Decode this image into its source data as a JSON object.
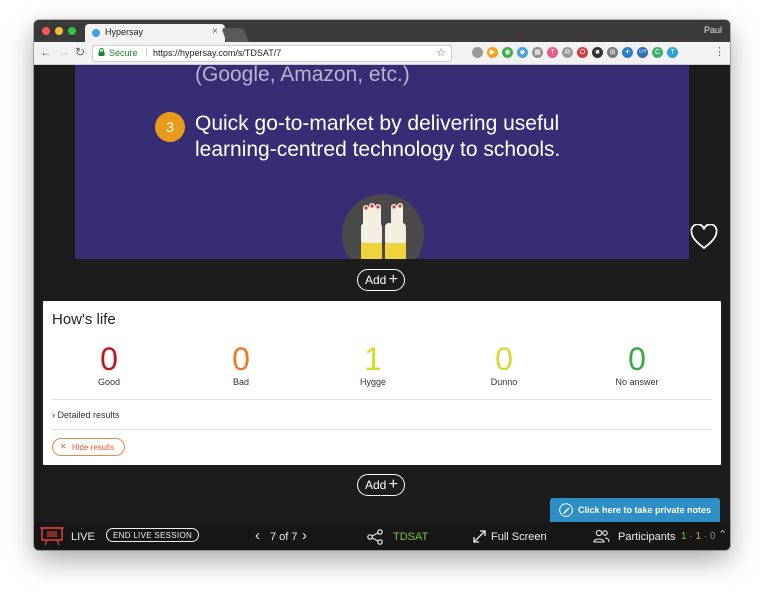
{
  "browser": {
    "tab_title": "Hypersay",
    "tab_close": "×",
    "profile_name": "Paul",
    "secure_label": "Secure",
    "url": "https://hypersay.com/s/TDSAT/7",
    "extensions": [
      {
        "name": "ext-grey-icon",
        "color": "#9a9a9a",
        "glyph": ""
      },
      {
        "name": "ext-orange-icon",
        "color": "#f4a21b",
        "glyph": "▶"
      },
      {
        "name": "ext-green-icon",
        "color": "#3fae49",
        "glyph": "◉"
      },
      {
        "name": "ext-diamond-icon",
        "color": "#4aa3df",
        "glyph": "◆"
      },
      {
        "name": "ext-grey2-icon",
        "color": "#8c8c8c",
        "glyph": "▦"
      },
      {
        "name": "ext-pink-icon",
        "color": "#e55b8a",
        "glyph": "T"
      },
      {
        "name": "ext-mail-icon",
        "color": "#9a9a9a",
        "glyph": "✉"
      },
      {
        "name": "ext-red-icon",
        "color": "#d23b3b",
        "glyph": "O"
      },
      {
        "name": "ext-dark-icon",
        "color": "#333333",
        "glyph": "■"
      },
      {
        "name": "ext-grid-icon",
        "color": "#777777",
        "glyph": "⊞"
      },
      {
        "name": "ext-blue-icon",
        "color": "#2a7fd4",
        "glyph": "✦"
      },
      {
        "name": "ext-lh-icon",
        "color": "#2f6fb5",
        "glyph": "LH"
      },
      {
        "name": "ext-c-icon",
        "color": "#3eb06f",
        "glyph": "C"
      },
      {
        "name": "ext-t-icon",
        "color": "#2fa3d8",
        "glyph": "T"
      }
    ]
  },
  "slide": {
    "line_top": "(Google, Amazon, etc.)",
    "badge_number": "3",
    "line_1": "Quick go-to-market by delivering useful",
    "line_2": "learning-centred technology to schools."
  },
  "add_label": "Add",
  "results": {
    "title": "How's life",
    "counters": [
      {
        "value": "0",
        "label": "Good",
        "color": "#c0161d"
      },
      {
        "value": "0",
        "label": "Bad",
        "color": "#ea7a26"
      },
      {
        "value": "1",
        "label": "Hygge",
        "color": "#cfdc2c"
      },
      {
        "value": "0",
        "label": "Dunno",
        "color": "#d9d63a"
      },
      {
        "value": "0",
        "label": "No answer",
        "color": "#3aa83c"
      }
    ],
    "detailed_label": "Detailed results",
    "hide_label": "Hide results"
  },
  "notes_label": "Click here to take private notes",
  "bottom": {
    "live_label": "LIVE",
    "end_label": "END LIVE SESSION",
    "pager_text": "7 of 7",
    "code": "TDSAT",
    "fullscreen_label": "Full Screen",
    "participants_label": "Participants",
    "count_1": "1",
    "count_2": "1",
    "count_3": "0"
  }
}
